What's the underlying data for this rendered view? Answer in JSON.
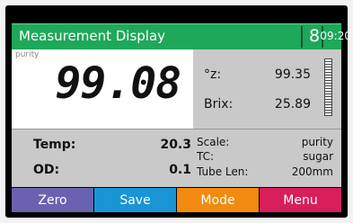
{
  "header": {
    "title": "Measurement Display",
    "battery_glyph": "8",
    "time": "09:20",
    "color": "#1ea85a"
  },
  "reading": {
    "mode_label": "purity",
    "value": "99.08"
  },
  "side": {
    "rows": [
      {
        "label": "°z:",
        "value": "99.35"
      },
      {
        "label": "Brix:",
        "value": "25.89"
      }
    ],
    "gauge_icon": "bar-gauge-icon"
  },
  "conditions": {
    "temp_label": "Temp:",
    "temp_value": "20.3",
    "od_label": "OD:",
    "od_value": "0.1"
  },
  "settings": {
    "scale_label": "Scale:",
    "scale_value": "purity",
    "tc_label": "TC:",
    "tc_value": "sugar",
    "tube_label": "Tube Len:",
    "tube_value": "200mm"
  },
  "footer": {
    "buttons": [
      {
        "label": "Zero",
        "color": "#6a62b0"
      },
      {
        "label": "Save",
        "color": "#1a95d6"
      },
      {
        "label": "Mode",
        "color": "#f28a0f"
      },
      {
        "label": "Menu",
        "color": "#d81e5b"
      }
    ]
  }
}
